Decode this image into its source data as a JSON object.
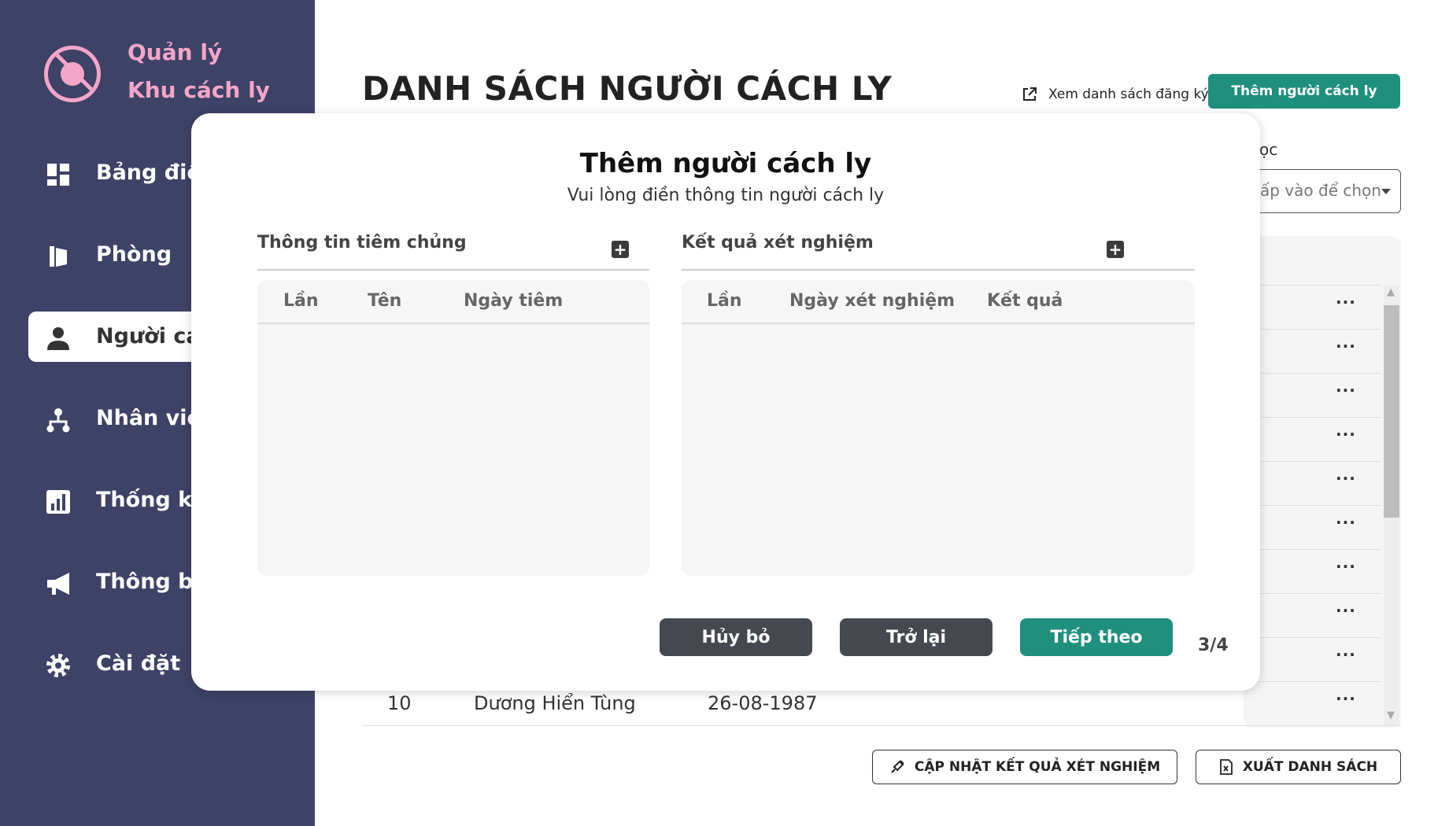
{
  "brand": {
    "line1": "Quản lý",
    "line2": "Khu cách ly",
    "color": "#f4a6c8"
  },
  "sidebar": {
    "bg": "#3e4266",
    "items": [
      {
        "label": "Bảng điều",
        "icon": "dashboard-icon"
      },
      {
        "label": "Phòng",
        "icon": "door-icon"
      },
      {
        "label": "Người các",
        "icon": "person-icon",
        "active": true
      },
      {
        "label": "Nhân viên",
        "icon": "org-chart-icon"
      },
      {
        "label": "Thống kê",
        "icon": "bar-chart-icon"
      },
      {
        "label": "Thông bá",
        "icon": "megaphone-icon"
      },
      {
        "label": "Cài đặt",
        "icon": "gear-icon"
      }
    ]
  },
  "header": {
    "title": "DANH SÁCH NGƯỜI CÁCH LY",
    "view_registrations": "Xem danh sách đăng ký",
    "add_button": "Thêm người cách ly"
  },
  "filter": {
    "label": "ọc",
    "placeholder": "ấp vào để chọn"
  },
  "table": {
    "row_action": "···",
    "last_row": {
      "index": "10",
      "name": "Dương Hiển Tùng",
      "dob": "26-08-1987"
    }
  },
  "footer": {
    "update_tests": "CẬP NHẬT KẾT QUẢ XÉT NGHIỆM",
    "export_list": "XUẤT DANH SÁCH"
  },
  "modal": {
    "title": "Thêm người cách ly",
    "subtitle": "Vui lòng điền thông tin người cách ly",
    "vaccination": {
      "label": "Thông tin tiêm chủng",
      "columns": [
        "Lần",
        "Tên",
        "Ngày tiêm"
      ]
    },
    "tests": {
      "label": "Kết quả xét nghiệm",
      "columns": [
        "Lần",
        "Ngày xét nghiệm",
        "Kết quả"
      ]
    },
    "cancel": "Hủy bỏ",
    "back": "Trở lại",
    "next": "Tiếp theo",
    "step": "3/4"
  },
  "colors": {
    "accent": "#1f8f7e",
    "dark_button": "#464850"
  }
}
